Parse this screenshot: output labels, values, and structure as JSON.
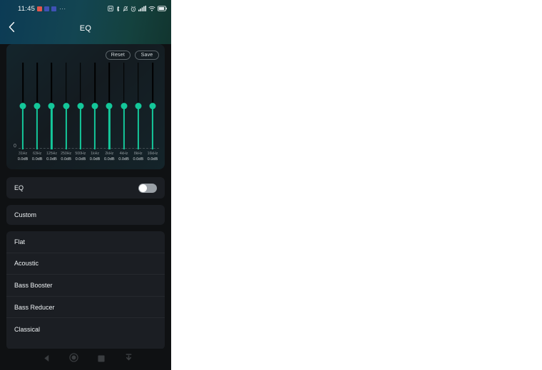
{
  "status_bar": {
    "time": "11:45",
    "notification_icons": [
      "mail-icon",
      "app-icon-1",
      "app-icon-2"
    ],
    "overflow": "···",
    "system_icons": [
      "nfc-icon",
      "bluetooth-icon",
      "vibrate-icon",
      "alarm-icon",
      "signal-icon",
      "wifi-icon",
      "battery-icon"
    ],
    "battery_level": "70"
  },
  "app_bar": {
    "back_icon": "chevron-left-icon",
    "title": "EQ"
  },
  "eq_card": {
    "reset_label": "Reset",
    "save_label": "Save",
    "zero_label": "0",
    "bands": [
      {
        "freq": "31Hz",
        "gain": "0.0dB"
      },
      {
        "freq": "63Hz",
        "gain": "0.0dB"
      },
      {
        "freq": "125Hz",
        "gain": "0.0dB"
      },
      {
        "freq": "250Hz",
        "gain": "0.0dB"
      },
      {
        "freq": "500Hz",
        "gain": "0.0dB"
      },
      {
        "freq": "1kHz",
        "gain": "0.0dB"
      },
      {
        "freq": "2kHz",
        "gain": "0.0dB"
      },
      {
        "freq": "4kHz",
        "gain": "0.0dB"
      },
      {
        "freq": "8kHz",
        "gain": "0.0dB"
      },
      {
        "freq": "16kHz",
        "gain": "0.0dB"
      }
    ],
    "accent_color": "#14c79a"
  },
  "eq_toggle": {
    "label": "EQ",
    "state": "off"
  },
  "custom_row": {
    "label": "Custom"
  },
  "presets": [
    {
      "label": "Flat"
    },
    {
      "label": "Acoustic"
    },
    {
      "label": "Bass Booster"
    },
    {
      "label": "Bass Reducer"
    },
    {
      "label": "Classical"
    }
  ],
  "nav_bar": {
    "back": "back-triangle-icon",
    "home": "home-circle-icon",
    "recents": "recents-square-icon",
    "collapse": "collapse-down-icon"
  }
}
